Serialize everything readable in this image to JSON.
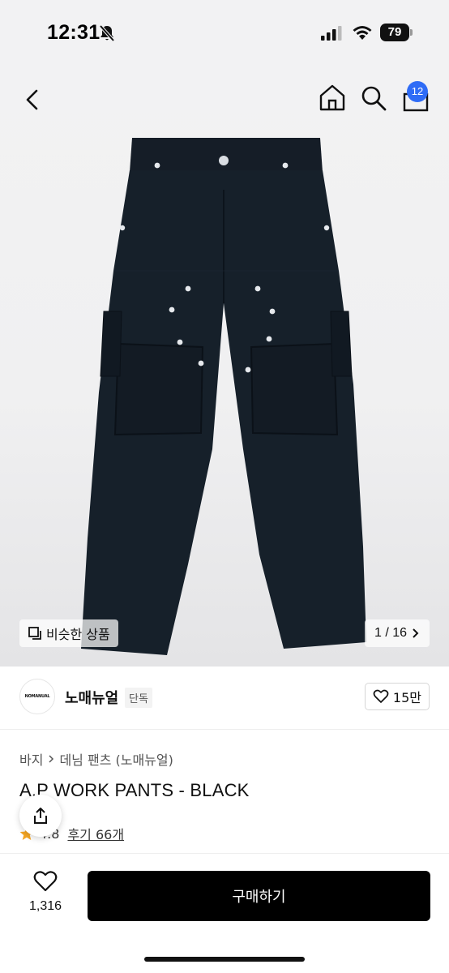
{
  "status_bar": {
    "time": "12:31",
    "battery": "79"
  },
  "header": {
    "cart_count": "12"
  },
  "gallery": {
    "similar_label": "비슷한 상품",
    "page_indicator": "1 / 16"
  },
  "brand": {
    "logo_text": "NOMANUAL",
    "name": "노매뉴얼",
    "tag": "단독",
    "likes": "15만"
  },
  "product": {
    "breadcrumb": [
      "바지",
      "데님 팬츠 (노매뉴얼)"
    ],
    "title": "A.P WORK PANTS - BLACK",
    "rating": "4.8",
    "review_label": "후기 66개"
  },
  "bottom": {
    "wish_count": "1,316",
    "buy_label": "구매하기"
  },
  "colors": {
    "accent": "#2f6cf6",
    "buy_button": "#000000",
    "star": "#f5a623",
    "pants": "#16202a"
  }
}
